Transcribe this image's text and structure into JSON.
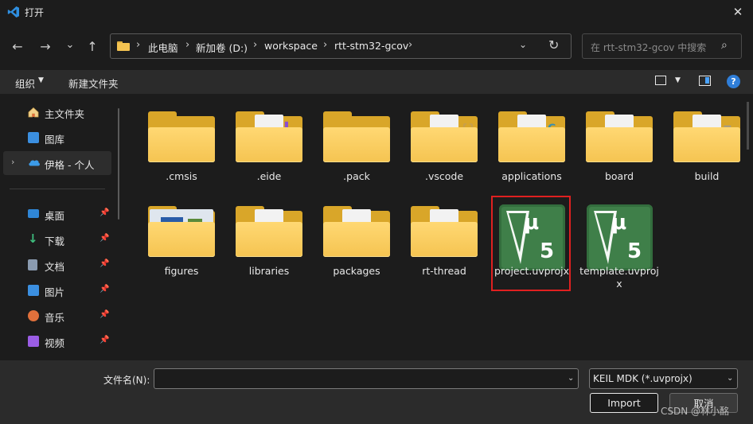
{
  "window": {
    "title": "打开"
  },
  "nav": {
    "back": "←",
    "forward": "→",
    "recent": "⌄",
    "up": "↑"
  },
  "address": {
    "crumbs": [
      "此电脑",
      "新加卷 (D:)",
      "workspace",
      "rtt-stm32-gcov"
    ]
  },
  "search": {
    "placeholder": "在 rtt-stm32-gcov 中搜索"
  },
  "toolbar": {
    "organize": "组织",
    "new_folder": "新建文件夹"
  },
  "sidebar": {
    "items": [
      {
        "label": "主文件夹",
        "icon": "home-icon",
        "color": "#e8e8e8"
      },
      {
        "label": "图库",
        "icon": "gallery-icon",
        "color": "#3b8fe0"
      },
      {
        "label": "伊格 - 个人",
        "icon": "onedrive-icon",
        "color": "#3c9be8"
      },
      {
        "label": "桌面",
        "icon": "desktop-icon",
        "color": "#3b8fe0"
      },
      {
        "label": "下载",
        "icon": "download-icon",
        "color": "#3fbf7f"
      },
      {
        "label": "文档",
        "icon": "document-icon",
        "color": "#8a9bb0"
      },
      {
        "label": "图片",
        "icon": "pictures-icon",
        "color": "#3b8fe0"
      },
      {
        "label": "音乐",
        "icon": "music-icon",
        "color": "#e0703b"
      },
      {
        "label": "视频",
        "icon": "video-icon",
        "color": "#9b5de5"
      }
    ]
  },
  "files": [
    {
      "name": ".cmsis",
      "kind": "folder",
      "mark": ""
    },
    {
      "name": ".eide",
      "kind": "folder-doc",
      "mark": "▍",
      "mark_color": "#8a4fd0"
    },
    {
      "name": ".pack",
      "kind": "folder",
      "mark": ""
    },
    {
      "name": ".vscode",
      "kind": "folder-doc",
      "mark": "{}",
      "mark_color": "#c8a04a"
    },
    {
      "name": "applications",
      "kind": "folder-doc",
      "mark": "C",
      "mark_color": "#3a8fb0"
    },
    {
      "name": "board",
      "kind": "folder-doc",
      "mark": ""
    },
    {
      "name": "build",
      "kind": "folder-doc",
      "mark": "≡",
      "mark_color": "#9a9a9a"
    },
    {
      "name": "figures",
      "kind": "folder-img",
      "mark": ""
    },
    {
      "name": "libraries",
      "kind": "folder-doc",
      "mark": ""
    },
    {
      "name": "packages",
      "kind": "folder-doc",
      "mark": ""
    },
    {
      "name": "rt-thread",
      "kind": "folder-doc",
      "mark": ""
    },
    {
      "name": "project.uvprojx",
      "kind": "uvision",
      "selected": true
    },
    {
      "name": "template.uvproj\nx",
      "kind": "uvision"
    }
  ],
  "bottom": {
    "filename_label": "文件名(N):",
    "filename_value": "",
    "filetype_value": "KEIL MDK (*.uvprojx)",
    "import_label": "Import",
    "cancel_label": "取消"
  },
  "watermark": "CSDN @林小酩"
}
